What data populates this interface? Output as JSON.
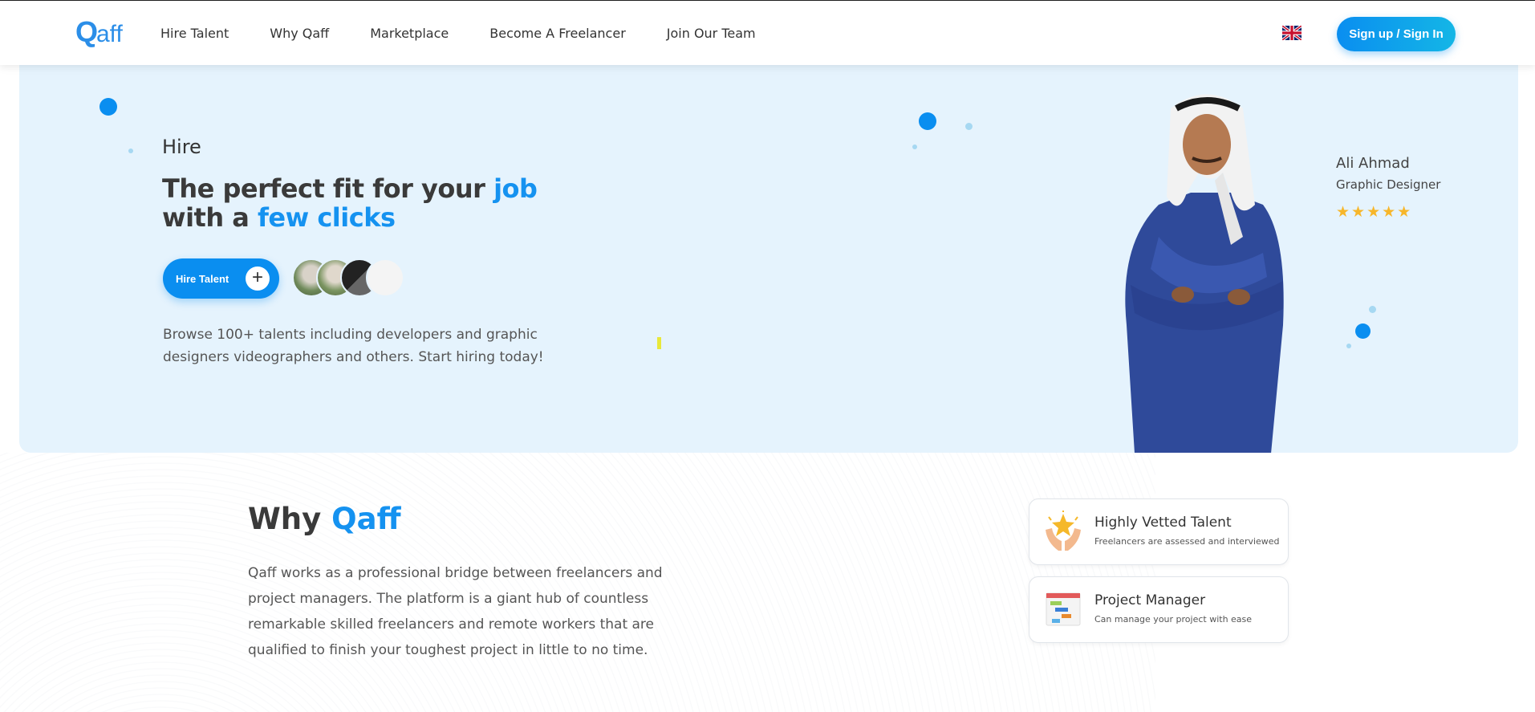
{
  "header": {
    "logo_text": "Qaff",
    "nav": [
      "Hire Talent",
      "Why Qaff",
      "Marketplace",
      "Become A Freelancer",
      "Join Our Team"
    ],
    "language_icon": "uk-flag-icon",
    "signup_label": "Sign up / Sign In"
  },
  "hero": {
    "subtitle": "Hire",
    "title_part1": "The perfect fit for your ",
    "title_hl1": "job",
    "title_part2": " with a ",
    "title_hl2": "few clicks",
    "cta_label": "Hire Talent",
    "cta_icon": "plus-icon",
    "description": "Browse 100+ talents including developers and graphic designers videographers and others. Start hiring today!",
    "profile": {
      "name": "Ali Ahmad",
      "role": "Graphic Designer",
      "stars": "★★★★★",
      "rating": 5
    }
  },
  "why": {
    "title_part1": "Why ",
    "title_hl": "Qaff",
    "description": "Qaff works as a professional bridge between freelancers and project managers. The platform is a giant hub of countless remarkable skilled freelancers and remote workers that are qualified to finish your toughest project in little to no time.",
    "features": [
      {
        "icon": "star-hands-icon",
        "title": "Highly Vetted Talent",
        "subtitle": "Freelancers are assessed and interviewed"
      },
      {
        "icon": "gantt-chart-icon",
        "title": "Project Manager",
        "subtitle": "Can manage your project with ease"
      }
    ]
  },
  "colors": {
    "accent": "#0a8ef0",
    "hero_bg": "#e5f3fd",
    "star": "#f7b62a"
  }
}
